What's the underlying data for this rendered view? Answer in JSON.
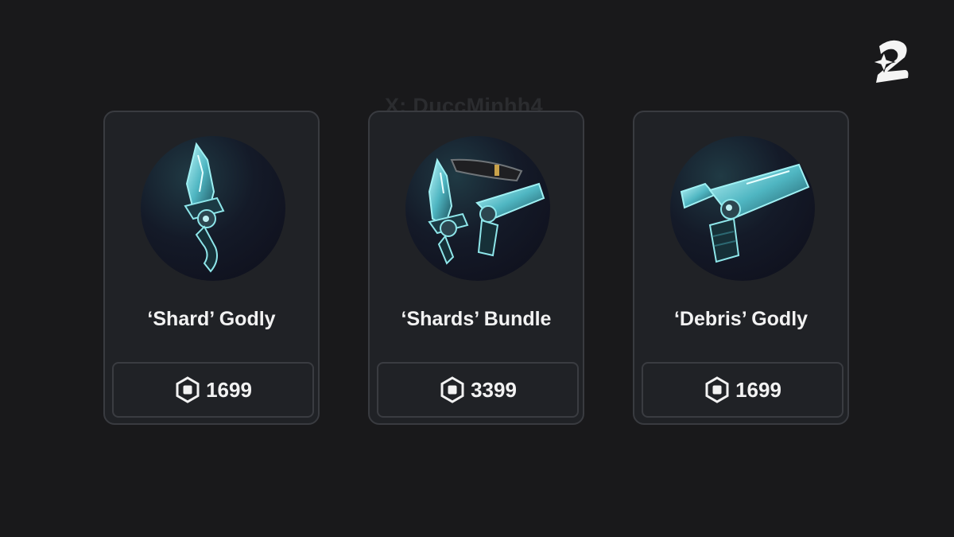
{
  "watermark": "X: DuccMinhh4",
  "icons": {
    "logo": "brand-logo",
    "currency": "robux-icon"
  },
  "colors": {
    "background": "#19191b",
    "card": "#202226",
    "border": "#393b40",
    "accent": "#7fe3e8"
  },
  "cards": [
    {
      "title": "‘Shard’ Godly",
      "price": "1699",
      "art": "shard-knife"
    },
    {
      "title": "‘Shards’ Bundle",
      "price": "3399",
      "art": "shard-bundle"
    },
    {
      "title": "‘Debris’ Godly",
      "price": "1699",
      "art": "debris-gun"
    }
  ]
}
